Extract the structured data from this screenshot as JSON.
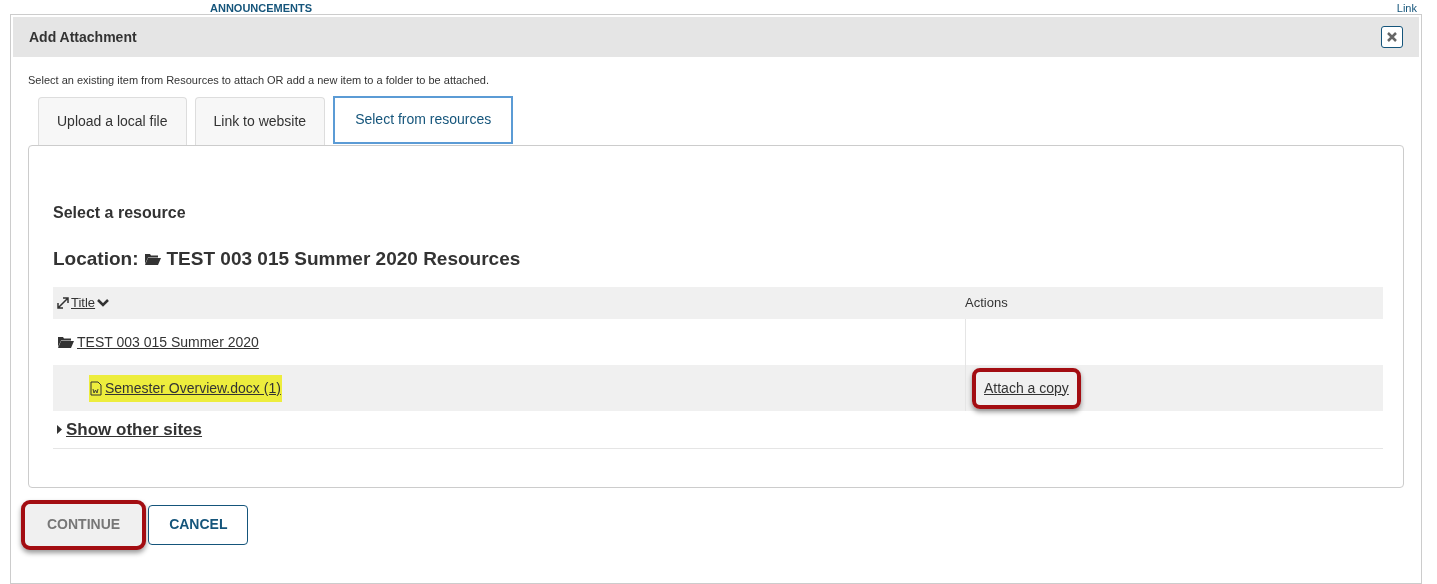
{
  "background": {
    "heading": "ANNOUNCEMENTS",
    "link": "Link"
  },
  "dialog": {
    "title": "Add Attachment",
    "instructions": "Select an existing item from Resources to attach OR add a new item to a folder to be attached.",
    "tabs": [
      {
        "label": "Upload a local file",
        "selected": false
      },
      {
        "label": "Link to website",
        "selected": false
      },
      {
        "label": "Select from resources",
        "selected": true
      }
    ],
    "section_title": "Select a resource",
    "location_label": "Location:",
    "location": "TEST 003 015 Summer 2020 Resources",
    "table": {
      "columns": [
        "Title",
        "Actions"
      ],
      "rows": [
        {
          "kind": "folder",
          "title": "TEST 003 015 Summer 2020",
          "highlighted": false
        },
        {
          "kind": "file",
          "title": "Semester Overview.docx (1)",
          "highlighted": true,
          "action": "Attach a copy",
          "action_callout": true
        }
      ]
    },
    "show_other_sites": "Show other sites",
    "buttons": [
      {
        "label": "CONTINUE",
        "kind": "primary",
        "callout": true
      },
      {
        "label": "CANCEL",
        "kind": "secondary",
        "callout": false
      }
    ]
  }
}
